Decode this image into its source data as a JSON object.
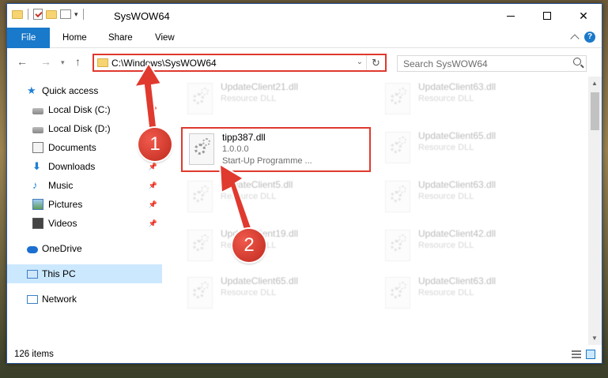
{
  "window": {
    "title": "SysWOW64"
  },
  "ribbon": {
    "tabs": [
      {
        "label": "File"
      },
      {
        "label": "Home"
      },
      {
        "label": "Share"
      },
      {
        "label": "View"
      }
    ]
  },
  "address_bar": {
    "path": "C:\\Windows\\SysWOW64"
  },
  "search": {
    "placeholder": "Search SysWOW64"
  },
  "sidebar": {
    "items": [
      {
        "label": "Quick access",
        "icon": "star-icon"
      },
      {
        "label": "Local Disk (C:)",
        "icon": "disk-icon",
        "pinned": true
      },
      {
        "label": "Local Disk (D:)",
        "icon": "disk-icon",
        "pinned": true
      },
      {
        "label": "Documents",
        "icon": "documents-icon",
        "pinned": true
      },
      {
        "label": "Downloads",
        "icon": "download-icon",
        "pinned": true
      },
      {
        "label": "Music",
        "icon": "music-icon",
        "pinned": true
      },
      {
        "label": "Pictures",
        "icon": "pictures-icon",
        "pinned": true
      },
      {
        "label": "Videos",
        "icon": "videos-icon",
        "pinned": true
      },
      {
        "label": "OneDrive",
        "icon": "onedrive-icon"
      },
      {
        "label": "This PC",
        "icon": "this-pc-icon",
        "selected": true
      },
      {
        "label": "Network",
        "icon": "network-icon"
      }
    ]
  },
  "files": [
    {
      "name": "UpdateClient21.dll",
      "type": "Resource DLL",
      "faded": true
    },
    {
      "name": "UpdateClient63.dll",
      "type": "Resource DLL",
      "faded": true
    },
    {
      "name": "tipp387.dll",
      "version": "1.0.0.0",
      "description": "Start-Up Programme ...",
      "highlighted": true
    },
    {
      "name": "UpdateClient65.dll",
      "type": "Resource DLL",
      "faded": true
    },
    {
      "name": "UpdateClient5.dll",
      "type": "Resource DLL",
      "faded": true
    },
    {
      "name": "UpdateClient63.dll",
      "type": "Resource DLL",
      "faded": true
    },
    {
      "name": "UpdateClient19.dll",
      "type": "Resource DLL",
      "faded": true
    },
    {
      "name": "UpdateClient42.dll",
      "type": "Resource DLL",
      "faded": true
    },
    {
      "name": "UpdateClient65.dll",
      "type": "Resource DLL",
      "faded": true
    },
    {
      "name": "UpdateClient63.dll",
      "type": "Resource DLL",
      "faded": true
    }
  ],
  "status": {
    "item_count": "126 items"
  },
  "annotations": {
    "badge_1": "1",
    "badge_2": "2",
    "color": "#e0392e"
  }
}
